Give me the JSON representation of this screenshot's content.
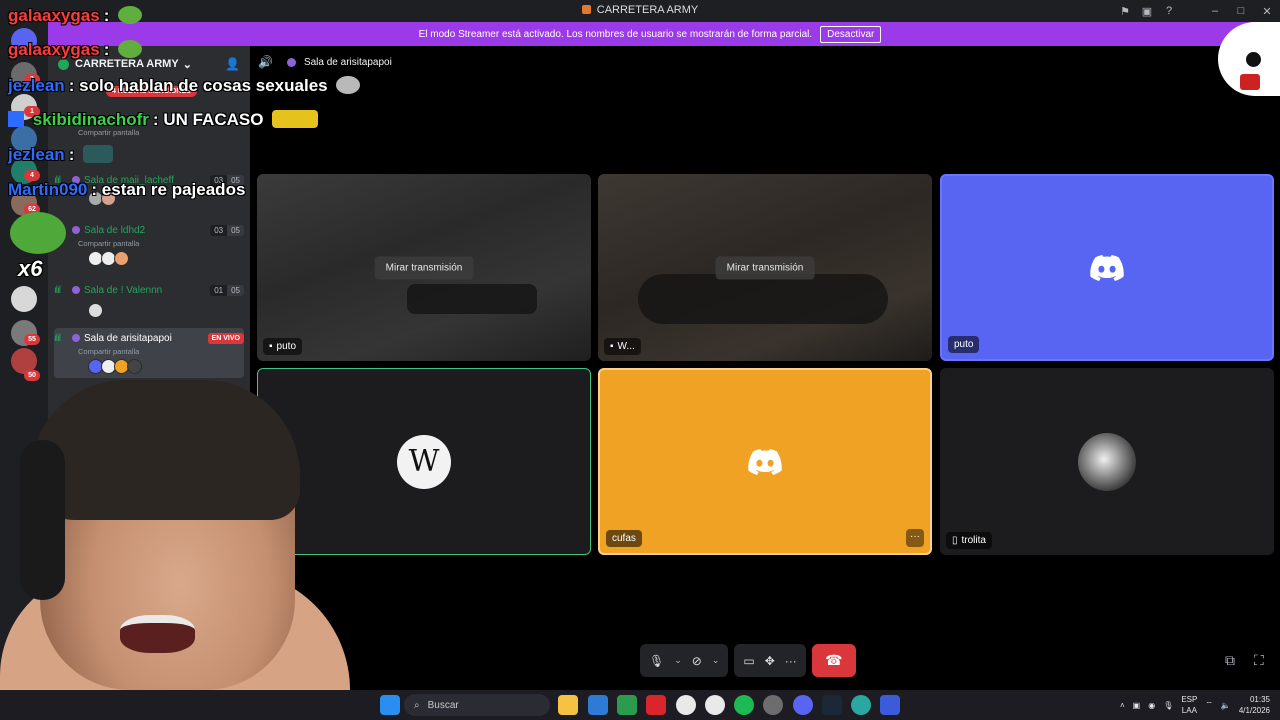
{
  "window": {
    "title": "CARRETERA ARMY"
  },
  "banner": {
    "text": "El modo Streamer está activado. Los nombres de usuario se mostrarán de forma parcial.",
    "button": "Desactivar"
  },
  "rail": {
    "badges": [
      "3",
      "1",
      "4",
      "62",
      "55",
      "50"
    ]
  },
  "server": {
    "name": "CARRETERA ARMY",
    "mentions": "4 NUEVAS MENCIONES"
  },
  "channels": [
    {
      "name": "Sala de maii_lacheff",
      "sub": "",
      "count_a": "03",
      "count_b": "05"
    },
    {
      "name": "Sala de ldhd2",
      "sub": "Compartir pantalla",
      "count_a": "03",
      "count_b": "05"
    },
    {
      "name": "Sala de ! Valennn",
      "sub": "",
      "count_a": "01",
      "count_b": "05"
    },
    {
      "name": "Sala de arisitapapoi",
      "sub": "Compartir pantalla",
      "live": "EN VIVO"
    }
  ],
  "first_channel_sub": "Compartir pantalla",
  "call": {
    "channel": "Sala de arisitapapoi"
  },
  "tiles": [
    {
      "tag": "puto",
      "watch": "Mirar transmisión"
    },
    {
      "tag": "W...",
      "watch": "Mirar transmisión"
    },
    {
      "tag": "puto"
    },
    {
      "tag": "...",
      "initial": "W"
    },
    {
      "tag": "cufas"
    },
    {
      "tag": "trolita"
    }
  ],
  "chat": [
    {
      "user": "galaaxygas",
      "sep": ":",
      "text": "",
      "color": "#ff3b3b"
    },
    {
      "user": "galaaxygas",
      "sep": ":",
      "text": "",
      "color": "#ff3b3b"
    },
    {
      "user": "jezlean",
      "sep": ":",
      "text": "solo hablan de cosas sexuales",
      "color": "#2e6bff"
    },
    {
      "user": "skibidinachofr",
      "sep": ":",
      "text": "UN FACASO",
      "color": "#3ad34a"
    },
    {
      "user": "jezlean",
      "sep": ":",
      "text": "",
      "color": "#2e6bff"
    },
    {
      "user": "Martin090",
      "sep": ":",
      "text": "estan re pajeados",
      "color": "#2e6bff"
    }
  ],
  "emote_multiplier": "x6",
  "taskbar": {
    "search": "Buscar",
    "lang_top": "ESP",
    "lang_bottom": "LAA",
    "time": "01:35",
    "date": "4/1/2026"
  },
  "colors": {
    "blurple": "#5865f2",
    "orange": "#f0a224",
    "danger": "#da373c",
    "online": "#23a55a",
    "banner": "#9b3ae8"
  }
}
